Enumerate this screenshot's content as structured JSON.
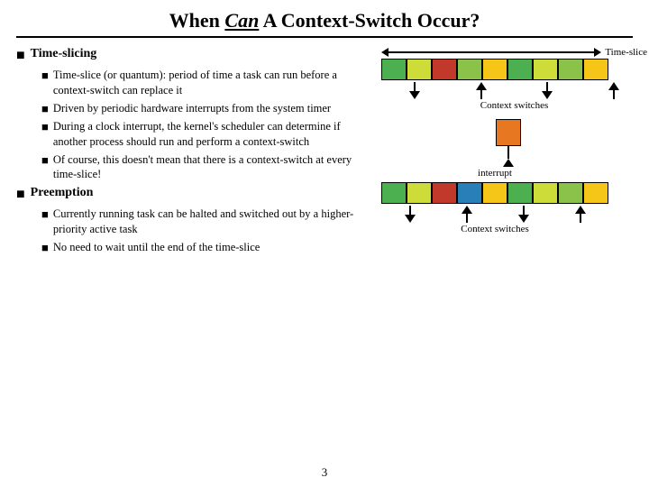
{
  "title": {
    "text": "When ",
    "can": "Can",
    "rest": " A Context-Switch Occur?"
  },
  "main_bullets": [
    {
      "id": "time-slicing",
      "label": "Time-slicing",
      "sub_bullets": [
        "Time-slice (or quantum): period of time a task can run before a context-switch can replace it",
        "Driven by periodic hardware interrupts from the system timer",
        "During a clock interrupt, the kernel's scheduler can determine if another process should run and perform a context-switch",
        "Of course, this doesn't mean that there is a context-switch at every time-slice!"
      ]
    },
    {
      "id": "preemption",
      "label": "Preemption",
      "sub_bullets": [
        "Currently running task can be halted and switched out by a higher-priority active task",
        "No need to wait until the end of the time-slice"
      ]
    }
  ],
  "diagram1": {
    "timeslice_label": "Time-slice",
    "context_switches_label": "Context switches"
  },
  "diagram2": {
    "interrupt_label": "interrupt",
    "context_switches_label": "Context switches"
  },
  "page_number": "3"
}
